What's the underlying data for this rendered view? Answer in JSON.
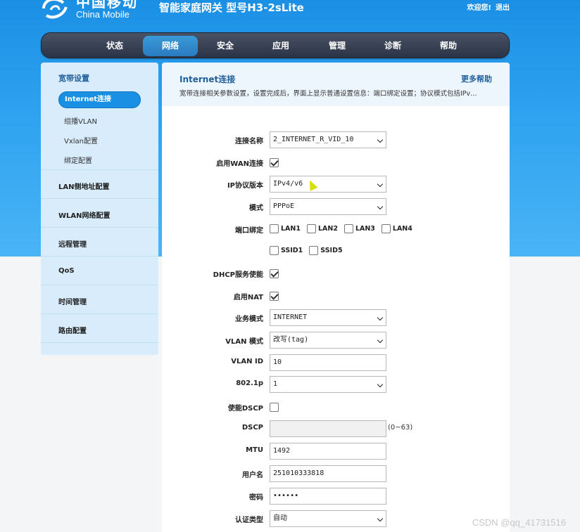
{
  "header": {
    "logo_cn": "中国移动",
    "logo_en": "China Mobile",
    "title": "智能家庭网关 型号H3-2sLite",
    "welcome": "欢迎您!",
    "logout": "退出"
  },
  "nav": [
    "状态",
    "网络",
    "安全",
    "应用",
    "管理",
    "诊断",
    "帮助"
  ],
  "nav_active": "网络",
  "sidebar": {
    "section1_head": "宽带设置",
    "sub_items": [
      "Internet连接",
      "组播VLAN",
      "Vxlan配置",
      "绑定配置"
    ],
    "items": [
      "LAN侧地址配置",
      "WLAN网络配置",
      "远程管理",
      "QoS",
      "时间管理",
      "路由配置"
    ]
  },
  "panel": {
    "title": "Internet连接",
    "help": "更多帮助",
    "desc": "宽带连接相关参数设置，设置完成后，界面上显示普通设置信息：端口绑定设置；协议模式包括IPv…"
  },
  "form": {
    "conn_name_label": "连接名称",
    "conn_name_value": "2_INTERNET_R_VID_10",
    "enable_wan_label": "启用WAN连接",
    "ip_ver_label": "IP协议版本",
    "ip_ver_value": "IPv4/v6",
    "mode_label": "模式",
    "mode_value": "PPPoE",
    "port_bind_label": "端口绑定",
    "ports": [
      "LAN1",
      "LAN2",
      "LAN3",
      "LAN4"
    ],
    "ssids": [
      "SSID1",
      "SSID5"
    ],
    "dhcp_label": "DHCP服务使能",
    "nat_label": "启用NAT",
    "service_label": "业务模式",
    "service_value": "INTERNET",
    "vlan_mode_label": "VLAN 模式",
    "vlan_mode_value": "改写(tag)",
    "vlan_id_label": "VLAN ID",
    "vlan_id_value": "10",
    "dot1p_label": "802.1p",
    "dot1p_value": "1",
    "dscp_enable_label": "使能DSCP",
    "dscp_label": "DSCP",
    "dscp_hint": "(0~63)",
    "mtu_label": "MTU",
    "mtu_value": "1492",
    "user_label": "用户名",
    "user_value": "251010333818",
    "pwd_label": "密码",
    "pwd_value": "••••••",
    "auth_label": "认证类型",
    "auth_value": "自动"
  },
  "watermark": "CSDN @qq_41731516",
  "colors": {
    "accent": "#1990e4",
    "nav_bg": "#2b3347",
    "sidebar_bg": "#d8ecfb"
  }
}
